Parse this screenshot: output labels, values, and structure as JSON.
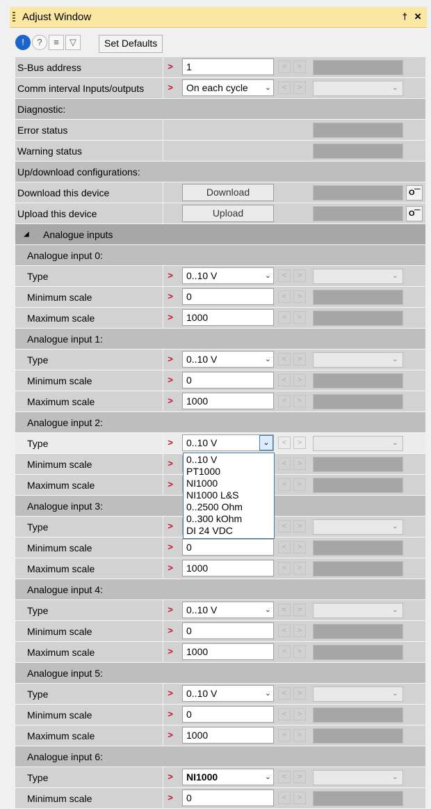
{
  "window": {
    "title": "Adjust Window",
    "pin": "\u0001",
    "close": "×"
  },
  "toolbar": {
    "set_defaults": "Set Defaults"
  },
  "rows": {
    "sbus": {
      "label": "S-Bus address",
      "value": "1"
    },
    "comm": {
      "label": "Comm interval Inputs/outputs",
      "value": "On each cycle"
    },
    "diagnostic": {
      "label": "Diagnostic:"
    },
    "error": {
      "label": "Error status"
    },
    "warning": {
      "label": "Warning status"
    },
    "updown": {
      "label": "Up/download configurations:"
    },
    "download": {
      "label": "Download this device",
      "button": "Download"
    },
    "upload": {
      "label": "Upload this device",
      "button": "Upload"
    },
    "analogue": {
      "label": "Analogue inputs"
    }
  },
  "inputs": [
    {
      "header": "Analogue input 0:",
      "type_label": "Type",
      "type": "0..10 V",
      "min_label": "Minimum scale",
      "min": "0",
      "max_label": "Maximum scale",
      "max": "1000"
    },
    {
      "header": "Analogue input 1:",
      "type_label": "Type",
      "type": "0..10 V",
      "min_label": "Minimum scale",
      "min": "0",
      "max_label": "Maximum scale",
      "max": "1000"
    },
    {
      "header": "Analogue input 2:",
      "type_label": "Type",
      "type": "0..10 V",
      "min_label": "Minimum scale",
      "min": "",
      "max_label": "Maximum scale",
      "max": ""
    },
    {
      "header": "Analogue input 3:",
      "type_label": "Type",
      "type": "",
      "min_label": "Minimum scale",
      "min": "0",
      "max_label": "Maximum scale",
      "max": "1000"
    },
    {
      "header": "Analogue input 4:",
      "type_label": "Type",
      "type": "0..10 V",
      "min_label": "Minimum scale",
      "min": "0",
      "max_label": "Maximum scale",
      "max": "1000"
    },
    {
      "header": "Analogue input 5:",
      "type_label": "Type",
      "type": "0..10 V",
      "min_label": "Minimum scale",
      "min": "0",
      "max_label": "Maximum scale",
      "max": "1000"
    },
    {
      "header": "Analogue input 6:",
      "type_label": "Type",
      "type": "NI1000",
      "min_label": "Minimum scale",
      "min": "0"
    }
  ],
  "dropdown_options": [
    "0..10 V",
    "PT1000",
    "NI1000",
    "NI1000 L&S",
    "0..2500 Ohm",
    "0..300 kOhm",
    "DI 24 VDC"
  ],
  "colors": {
    "title_bar": "#fbe7a4",
    "section": "#bebebe",
    "group": "#a7a7a7",
    "arrow": "#c8102e",
    "focus": "#3c7fb1"
  }
}
